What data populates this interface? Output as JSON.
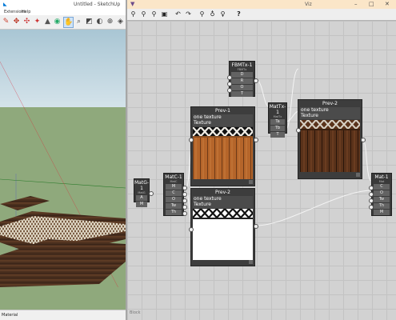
{
  "sketchup": {
    "title": "Untitled - SketchUp",
    "menu": [
      "Extensions",
      "Help"
    ],
    "status": "Material"
  },
  "viz": {
    "title": "Viz",
    "footer": "Block",
    "nodes": {
      "fbmtx": {
        "title": "FBMTx-1",
        "subtitle": "FBMTx",
        "ports": [
          "D",
          "R",
          "O",
          "T"
        ]
      },
      "mattx": {
        "title": "MatTx-1",
        "subtitle": "MatTx",
        "ports": [
          "Ta",
          "Tb",
          "T"
        ]
      },
      "matg": {
        "title": "MatG-1",
        "subtitle": "MatG",
        "ports": [
          "A",
          "M"
        ]
      },
      "matc": {
        "title": "MatC-1",
        "subtitle": "MatC",
        "ports": [
          "M",
          "C",
          "O",
          "Tw",
          "Th"
        ]
      },
      "mat": {
        "title": "Mat-1",
        "subtitle": "Mat",
        "ports": [
          "C",
          "O",
          "Tw",
          "Th",
          "M"
        ]
      }
    },
    "previews": {
      "prev1": {
        "title": "Prev-1",
        "line1": "one texture",
        "line2": "Texture"
      },
      "prev2": {
        "title": "Prev-2",
        "line1": "one texture",
        "line2": "Texture"
      },
      "prev3": {
        "title": "Prev-2",
        "line1": "one texture",
        "line2": "Texture"
      }
    },
    "toolbar_icons": [
      "zoom-in-icon",
      "zoom-out-icon",
      "zoom-fit-icon",
      "save-icon",
      "undo-icon",
      "redo-icon",
      "search-icon",
      "bulb-icon",
      "bulb-outline-icon",
      "help-icon"
    ]
  },
  "colors": {
    "viz_title_bg": "#fbe6c8",
    "node_bg": "#3a3a3a",
    "sky": "#bcd3de",
    "ground": "#8fa97c"
  }
}
